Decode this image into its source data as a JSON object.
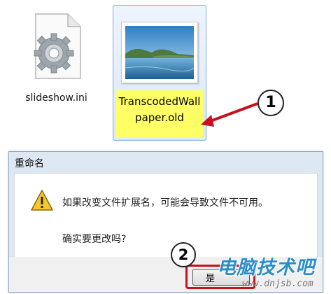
{
  "explorer": {
    "files": [
      {
        "name": "slideshow.ini",
        "icon": "settings-file-icon"
      },
      {
        "name_line1": "TranscodedWall",
        "name_line2": "paper.old",
        "icon": "image-thumbnail-icon"
      }
    ]
  },
  "callouts": {
    "step1": "1",
    "step2": "2"
  },
  "dialog": {
    "title": "重命名",
    "message": "如果改变文件扩展名，可能会导致文件不可用。",
    "question": "确实要更改吗?",
    "yes_label": "是",
    "icon": "warning-icon"
  },
  "watermark": {
    "title": "电脑技术吧",
    "url": "www.dnjsb.com"
  },
  "colors": {
    "highlight": "#ffff66",
    "accent_red": "#c8101e",
    "watermark_blue": "#2a8ec8"
  }
}
